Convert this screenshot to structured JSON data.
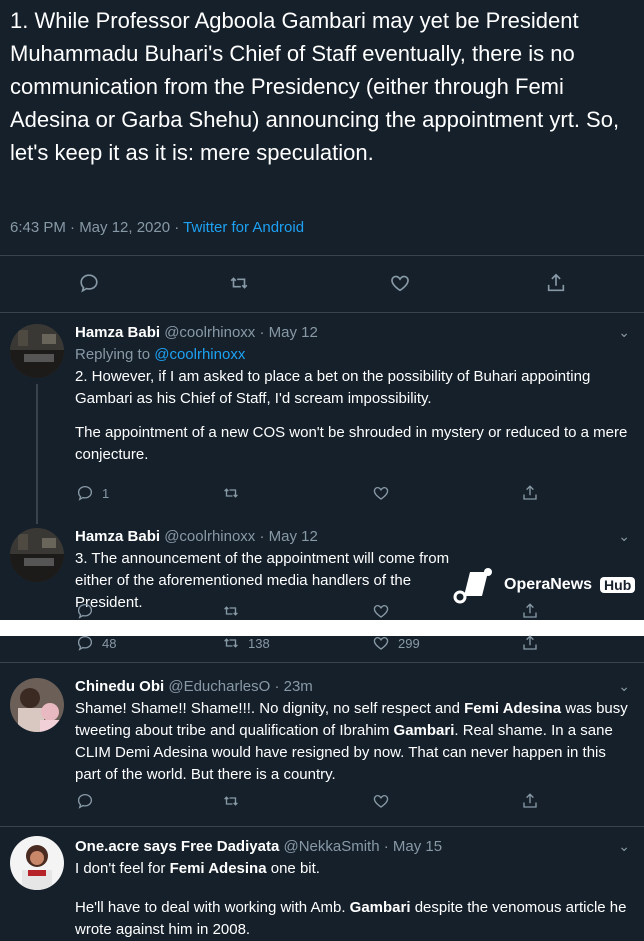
{
  "main_tweet": {
    "text": "1. While Professor Agboola Gambari may yet be President Muhammadu Buhari's Chief of Staff eventually,  there is no communication from the Presidency (either through Femi Adesina or Garba Shehu) announcing the appointment yrt. So, let's keep it as it is: mere speculation.",
    "time": "6:43 PM · May 12, 2020 · ",
    "client": "Twitter for Android"
  },
  "replies": [
    {
      "name": "Hamza Babi",
      "handle": "@coolrhinoxx · May 12",
      "replying_prefix": "Replying to ",
      "replying_to": "@coolrhinoxx",
      "text1": "2. However, if I am asked to place a bet on the possibility of Buhari appointing Gambari as his Chief of Staff, I'd scream impossibility.",
      "text2": "The appointment of a new COS won't be shrouded in mystery or reduced to a mere conjecture.",
      "reply_count": "1"
    },
    {
      "name": "Hamza Babi",
      "handle": "@coolrhinoxx · May 12",
      "text1": "3. The announcement of the appointment will come from either of the aforementioned media handlers of the President."
    },
    {
      "counts": {
        "replies": "48",
        "retweets": "138",
        "likes": "299"
      }
    },
    {
      "name": "Chinedu Obi",
      "handle": "@EducharlesO · 23m",
      "text_parts": [
        "Shame! Shame!! Shame!!!. No dignity, no self respect and ",
        "Femi Adesina",
        " was busy tweeting about tribe and qualification of Ibrahim ",
        "Gambari",
        ". Real shame. In a sane CLIM Demi Adesina would have resigned by now. That can never happen in this part of the world. But there is a country."
      ]
    },
    {
      "name": "One.acre says Free Dadiyata",
      "handle": "@NekkaSmith · May 15",
      "line1_parts": [
        "I don't feel for ",
        "Femi Adesina",
        " one bit."
      ],
      "line2_parts": [
        "He'll have to deal with working with Amb. ",
        "Gambari",
        " despite the venomous article he wrote against  him in 2008."
      ]
    }
  ],
  "watermark": {
    "text": "OperaNews",
    "hub": "Hub"
  },
  "colors": {
    "background": "#15202b",
    "divider": "#38444d",
    "muted": "#8899a6",
    "link": "#1da1f2"
  }
}
